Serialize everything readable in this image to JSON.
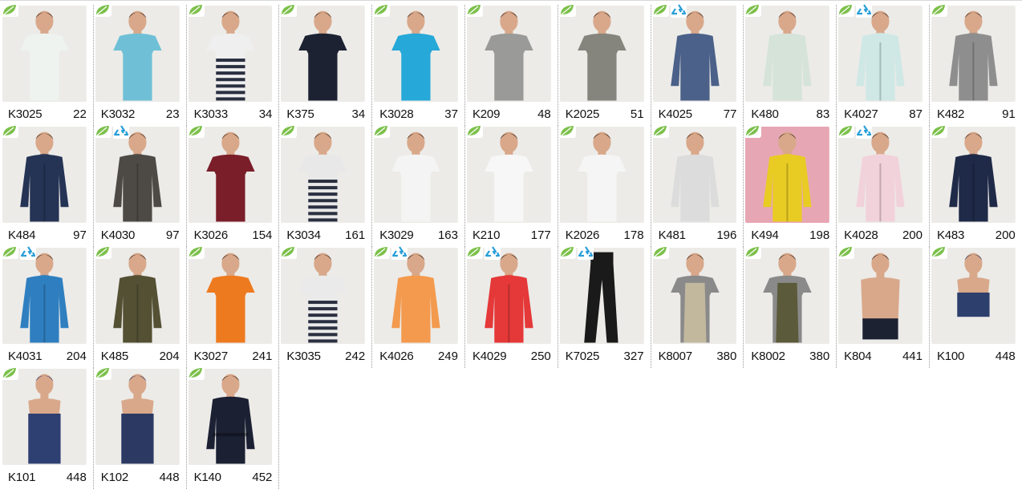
{
  "colors": {
    "leaf": "#7cc04a",
    "recycle": "#2a9fd8",
    "photo_bg": "#ecebe8"
  },
  "products": [
    {
      "code": "K3025",
      "page": "22",
      "badges": [
        "leaf"
      ],
      "shirt": "#eef3ef",
      "kind": "tee"
    },
    {
      "code": "K3032",
      "page": "23",
      "badges": [
        "leaf"
      ],
      "shirt": "#6fc0d6",
      "kind": "tee"
    },
    {
      "code": "K3033",
      "page": "34",
      "badges": [
        "leaf"
      ],
      "shirt": "#efefef",
      "kind": "stripe"
    },
    {
      "code": "K375",
      "page": "34",
      "badges": [
        "leaf"
      ],
      "shirt": "#1d2233",
      "kind": "tee"
    },
    {
      "code": "K3028",
      "page": "37",
      "badges": [
        "leaf"
      ],
      "shirt": "#26a8d8",
      "kind": "tee"
    },
    {
      "code": "K209",
      "page": "48",
      "badges": [
        "leaf"
      ],
      "shirt": "#9a9b98",
      "kind": "tee"
    },
    {
      "code": "K2025",
      "page": "51",
      "badges": [
        "leaf"
      ],
      "shirt": "#86857d",
      "kind": "tee"
    },
    {
      "code": "K4025",
      "page": "77",
      "badges": [
        "leaf",
        "recycle"
      ],
      "shirt": "#4b6189",
      "kind": "long"
    },
    {
      "code": "K480",
      "page": "83",
      "badges": [
        "leaf"
      ],
      "shirt": "#d5e3d8",
      "kind": "long"
    },
    {
      "code": "K4027",
      "page": "87",
      "badges": [
        "leaf",
        "recycle"
      ],
      "shirt": "#cfe8e6",
      "kind": "hood"
    },
    {
      "code": "K482",
      "page": "91",
      "badges": [
        "leaf"
      ],
      "shirt": "#8e8e8e",
      "kind": "hood"
    },
    {
      "code": "K484",
      "page": "97",
      "badges": [
        "leaf"
      ],
      "shirt": "#253455",
      "kind": "hood"
    },
    {
      "code": "K4030",
      "page": "97",
      "badges": [
        "leaf",
        "recycle"
      ],
      "shirt": "#4d4a46",
      "kind": "hood"
    },
    {
      "code": "K3026",
      "page": "154",
      "badges": [
        "leaf"
      ],
      "shirt": "#7a1e2a",
      "kind": "tee"
    },
    {
      "code": "K3034",
      "page": "161",
      "badges": [
        "leaf"
      ],
      "shirt": "#e8e8e8",
      "kind": "stripe"
    },
    {
      "code": "K3029",
      "page": "163",
      "badges": [
        "leaf"
      ],
      "shirt": "#f4f4f4",
      "kind": "tee"
    },
    {
      "code": "K210",
      "page": "177",
      "badges": [
        "leaf"
      ],
      "shirt": "#f7f7f7",
      "kind": "tee"
    },
    {
      "code": "K2026",
      "page": "178",
      "badges": [
        "leaf"
      ],
      "shirt": "#f5f5f5",
      "kind": "tee"
    },
    {
      "code": "K481",
      "page": "196",
      "badges": [
        "leaf"
      ],
      "shirt": "#dcdcdc",
      "kind": "long"
    },
    {
      "code": "K494",
      "page": "198",
      "badges": [
        "leaf"
      ],
      "shirt": "#e8cc24",
      "kind": "hood",
      "bg": "#e7a6b4"
    },
    {
      "code": "K4028",
      "page": "200",
      "badges": [
        "leaf",
        "recycle"
      ],
      "shirt": "#f2d2da",
      "kind": "hood"
    },
    {
      "code": "K483",
      "page": "200",
      "badges": [
        "leaf"
      ],
      "shirt": "#1f2a48",
      "kind": "hood"
    },
    {
      "code": "K4031",
      "page": "204",
      "badges": [
        "leaf",
        "recycle"
      ],
      "shirt": "#2f7fc0",
      "kind": "hood"
    },
    {
      "code": "K485",
      "page": "204",
      "badges": [
        "leaf"
      ],
      "shirt": "#535034",
      "kind": "hood"
    },
    {
      "code": "K3027",
      "page": "241",
      "badges": [
        "leaf"
      ],
      "shirt": "#ee7a1f",
      "kind": "tee"
    },
    {
      "code": "K3035",
      "page": "242",
      "badges": [
        "leaf"
      ],
      "shirt": "#eaeaea",
      "kind": "stripe"
    },
    {
      "code": "K4026",
      "page": "249",
      "badges": [
        "leaf",
        "recycle"
      ],
      "shirt": "#f39a4e",
      "kind": "long"
    },
    {
      "code": "K4029",
      "page": "250",
      "badges": [
        "leaf",
        "recycle"
      ],
      "shirt": "#e53838",
      "kind": "hood"
    },
    {
      "code": "K7025",
      "page": "327",
      "badges": [
        "leaf",
        "recycle"
      ],
      "shirt": "#1a1a1a",
      "kind": "pants"
    },
    {
      "code": "K8007",
      "page": "380",
      "badges": [
        "leaf"
      ],
      "shirt": "#c2b89e",
      "kind": "apron"
    },
    {
      "code": "K8002",
      "page": "380",
      "badges": [
        "leaf"
      ],
      "shirt": "#5b5a3a",
      "kind": "apron"
    },
    {
      "code": "K804",
      "page": "441",
      "badges": [
        "leaf"
      ],
      "shirt": "#1d2233",
      "kind": "trunks"
    },
    {
      "code": "K100",
      "page": "448",
      "badges": [
        "leaf"
      ],
      "shirt": "#2d3f6c",
      "kind": "towel"
    },
    {
      "code": "K101",
      "page": "448",
      "badges": [
        "leaf"
      ],
      "shirt": "#2e3f72",
      "kind": "wrap"
    },
    {
      "code": "K102",
      "page": "448",
      "badges": [
        "leaf"
      ],
      "shirt": "#2c3a63",
      "kind": "wrap"
    },
    {
      "code": "K140",
      "page": "452",
      "badges": [
        "leaf"
      ],
      "shirt": "#1c2033",
      "kind": "robe"
    }
  ]
}
